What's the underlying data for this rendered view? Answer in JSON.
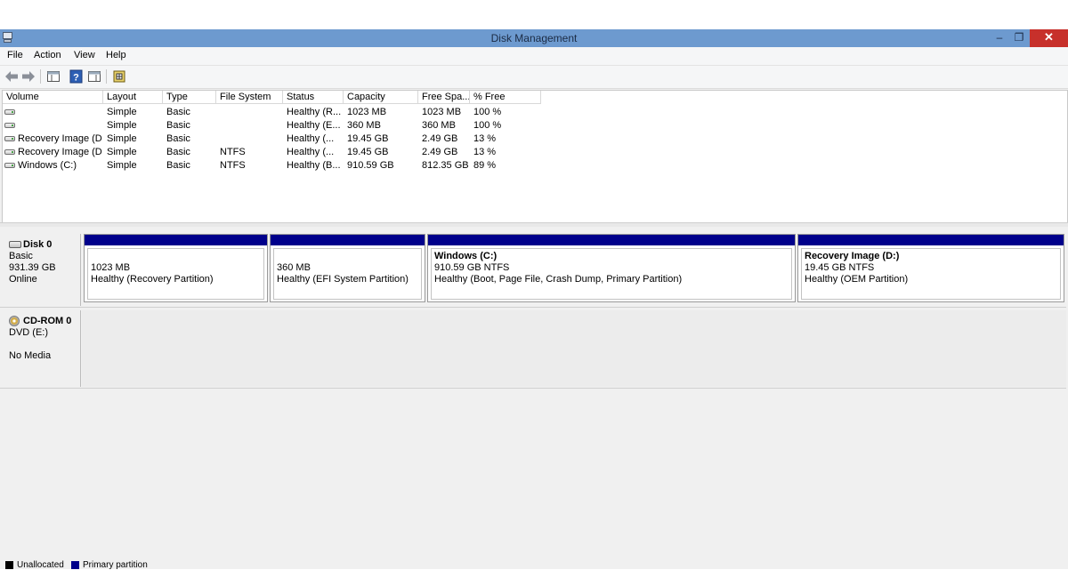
{
  "window": {
    "title": "Disk Management"
  },
  "window_controls": {
    "minimize": "–",
    "restore": "❐",
    "close": "✕"
  },
  "menu": [
    "File",
    "Action",
    "View",
    "Help"
  ],
  "toolbar_icons": [
    "back-icon",
    "forward-icon",
    "console-tree-icon",
    "help-icon",
    "properties-icon",
    "settings-icon"
  ],
  "volume_list": {
    "columns": [
      "Volume",
      "Layout",
      "Type",
      "File System",
      "Status",
      "Capacity",
      "Free Spa...",
      "% Free"
    ],
    "rows": [
      {
        "volume": "",
        "layout": "Simple",
        "type": "Basic",
        "fs": "",
        "status": "Healthy (R...",
        "capacity": "1023 MB",
        "free": "1023 MB",
        "pct": "100 %"
      },
      {
        "volume": "",
        "layout": "Simple",
        "type": "Basic",
        "fs": "",
        "status": "Healthy (E...",
        "capacity": "360 MB",
        "free": "360 MB",
        "pct": "100 %"
      },
      {
        "volume": "Recovery Image (D:)",
        "layout": "Simple",
        "type": "Basic",
        "fs": "",
        "status": "Healthy (...",
        "capacity": "19.45 GB",
        "free": "2.49 GB",
        "pct": "13 %"
      },
      {
        "volume": "Recovery Image (D:)",
        "layout": "Simple",
        "type": "Basic",
        "fs": "NTFS",
        "status": "Healthy (...",
        "capacity": "19.45 GB",
        "free": "2.49 GB",
        "pct": "13 %"
      },
      {
        "volume": "Windows (C:)",
        "layout": "Simple",
        "type": "Basic",
        "fs": "NTFS",
        "status": "Healthy (B...",
        "capacity": "910.59 GB",
        "free": "812.35 GB",
        "pct": "89 %"
      }
    ]
  },
  "disks": [
    {
      "name": "Disk 0",
      "type": "Basic",
      "size": "931.39 GB",
      "state": "Online",
      "partitions": [
        {
          "name": "",
          "size": "1023 MB",
          "status": "Healthy (Recovery Partition)"
        },
        {
          "name": "",
          "size": "360 MB",
          "status": "Healthy (EFI System Partition)"
        },
        {
          "name": "Windows  (C:)",
          "size": "910.59 GB NTFS",
          "status": "Healthy (Boot, Page File, Crash Dump, Primary Partition)"
        },
        {
          "name": "Recovery Image  (D:)",
          "size": "19.45 GB NTFS",
          "status": "Healthy (OEM Partition)"
        }
      ]
    },
    {
      "name": "CD-ROM 0",
      "type": "DVD (E:)",
      "media": "No Media"
    }
  ],
  "legend": [
    {
      "label": "Unallocated",
      "color": "#000000"
    },
    {
      "label": "Primary partition",
      "color": "#00008b"
    }
  ]
}
